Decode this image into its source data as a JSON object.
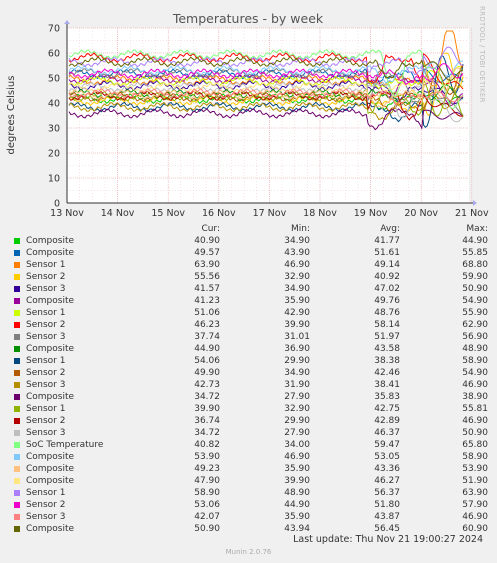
{
  "chart_data": {
    "type": "line",
    "title": "Temperatures - by week",
    "ylabel": "degrees Celsius",
    "xlabel": "",
    "ylim": [
      0,
      70
    ],
    "yticks": [
      0,
      10,
      20,
      30,
      40,
      50,
      60,
      70
    ],
    "xticks": [
      "13 Nov",
      "14 Nov",
      "15 Nov",
      "16 Nov",
      "17 Nov",
      "18 Nov",
      "19 Nov",
      "20 Nov",
      "21 Nov"
    ],
    "grid": true,
    "legend_position": "bottom",
    "columns": [
      "Cur:",
      "Min:",
      "Avg:",
      "Max:"
    ],
    "series": [
      {
        "name": "Composite",
        "color": "#00cc00",
        "cur": "40.90",
        "min": "34.90",
        "avg": "41.77",
        "max": "44.90"
      },
      {
        "name": "Composite",
        "color": "#0066b3",
        "cur": "49.57",
        "min": "43.90",
        "avg": "51.61",
        "max": "55.85"
      },
      {
        "name": "Sensor 1",
        "color": "#ff8000",
        "cur": "63.90",
        "min": "46.90",
        "avg": "49.14",
        "max": "68.80"
      },
      {
        "name": "Sensor 2",
        "color": "#ffcc00",
        "cur": "55.56",
        "min": "32.90",
        "avg": "40.92",
        "max": "59.90"
      },
      {
        "name": "Sensor 3",
        "color": "#330099",
        "cur": "41.57",
        "min": "34.90",
        "avg": "47.02",
        "max": "50.90"
      },
      {
        "name": "Composite",
        "color": "#990099",
        "cur": "41.23",
        "min": "35.90",
        "avg": "49.76",
        "max": "54.90"
      },
      {
        "name": "Sensor 1",
        "color": "#ccff00",
        "cur": "51.06",
        "min": "42.90",
        "avg": "48.76",
        "max": "55.90"
      },
      {
        "name": "Sensor 2",
        "color": "#ff0000",
        "cur": "46.23",
        "min": "39.90",
        "avg": "58.14",
        "max": "62.90"
      },
      {
        "name": "Sensor 3",
        "color": "#808080",
        "cur": "37.74",
        "min": "31.01",
        "avg": "51.97",
        "max": "56.90"
      },
      {
        "name": "Composite",
        "color": "#008f00",
        "cur": "44.90",
        "min": "36.90",
        "avg": "43.58",
        "max": "48.90"
      },
      {
        "name": "Sensor 1",
        "color": "#00487d",
        "cur": "54.06",
        "min": "29.90",
        "avg": "38.38",
        "max": "58.90"
      },
      {
        "name": "Sensor 2",
        "color": "#b35a00",
        "cur": "49.90",
        "min": "34.90",
        "avg": "42.46",
        "max": "54.90"
      },
      {
        "name": "Sensor 3",
        "color": "#b38f00",
        "cur": "42.73",
        "min": "31.90",
        "avg": "38.41",
        "max": "46.90"
      },
      {
        "name": "Composite",
        "color": "#6b006b",
        "cur": "34.72",
        "min": "27.90",
        "avg": "35.83",
        "max": "38.90"
      },
      {
        "name": "Sensor 1",
        "color": "#8fb300",
        "cur": "39.90",
        "min": "32.90",
        "avg": "42.75",
        "max": "55.81"
      },
      {
        "name": "Sensor 2",
        "color": "#b30000",
        "cur": "36.74",
        "min": "29.90",
        "avg": "42.89",
        "max": "46.90"
      },
      {
        "name": "Sensor 3",
        "color": "#bebebe",
        "cur": "34.72",
        "min": "27.90",
        "avg": "46.37",
        "max": "50.90"
      },
      {
        "name": "SoC Temperature",
        "color": "#80ff80",
        "cur": "40.82",
        "min": "34.00",
        "avg": "59.47",
        "max": "65.80"
      },
      {
        "name": "Composite",
        "color": "#80c9ff",
        "cur": "53.90",
        "min": "46.90",
        "avg": "53.05",
        "max": "58.90"
      },
      {
        "name": "Composite",
        "color": "#ffc080",
        "cur": "49.23",
        "min": "35.90",
        "avg": "43.36",
        "max": "53.90"
      },
      {
        "name": "Composite",
        "color": "#ffe680",
        "cur": "47.90",
        "min": "39.90",
        "avg": "46.27",
        "max": "51.90"
      },
      {
        "name": "Sensor 1",
        "color": "#aa80ff",
        "cur": "58.90",
        "min": "48.90",
        "avg": "56.37",
        "max": "63.90"
      },
      {
        "name": "Sensor 2",
        "color": "#ee00cc",
        "cur": "53.06",
        "min": "44.90",
        "avg": "51.80",
        "max": "57.90"
      },
      {
        "name": "Sensor 3",
        "color": "#ff8080",
        "cur": "42.07",
        "min": "35.90",
        "avg": "43.87",
        "max": "46.90"
      },
      {
        "name": "Composite",
        "color": "#666600",
        "cur": "50.90",
        "min": "43.94",
        "avg": "56.45",
        "max": "60.90"
      }
    ]
  },
  "footer": {
    "last_update": "Last update: Thu Nov 21 19:00:27 2024",
    "generator": "Munin 2.0.76"
  },
  "side_label": "RRDTOOL / TOBI OETIKER"
}
